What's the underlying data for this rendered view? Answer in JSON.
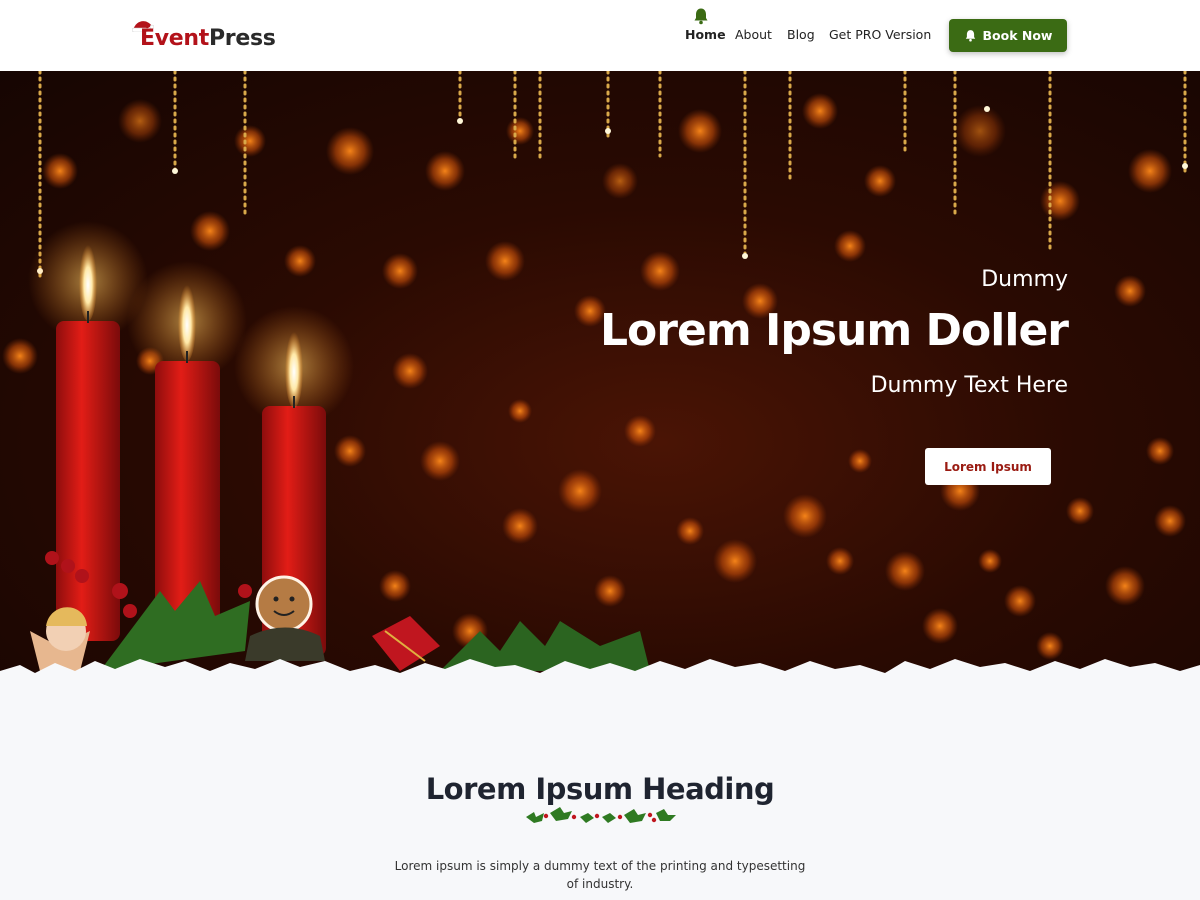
{
  "header": {
    "logo": {
      "part1": "Event",
      "part2": "Press"
    },
    "nav": [
      {
        "label": "Home"
      },
      {
        "label": "About"
      },
      {
        "label": "Blog"
      },
      {
        "label": "Get PRO Version"
      }
    ],
    "cta_label": "Book Now",
    "colors": {
      "brand_red": "#b3121a",
      "cta_green": "#3b6b14",
      "bell_green": "#3b6b14"
    }
  },
  "hero": {
    "subtitle_top": "Dummy",
    "title": "Lorem Ipsum Doller",
    "subtitle_bottom": "Dummy Text Here",
    "button_label": "Lorem Ipsum"
  },
  "section": {
    "heading": "Lorem Ipsum Heading",
    "text": "Lorem ipsum is simply a dummy text of the printing and typesetting of industry."
  }
}
